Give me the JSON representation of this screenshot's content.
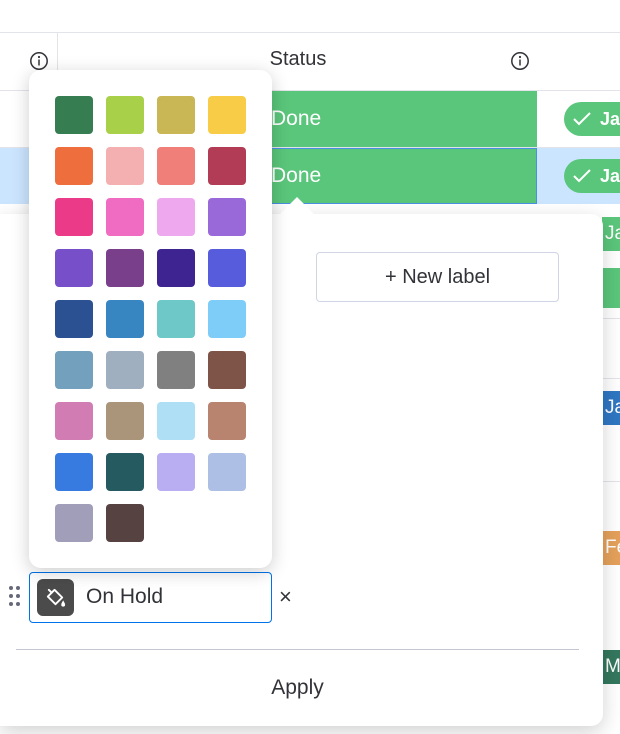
{
  "board": {
    "column_title": "Status",
    "rows": [
      {
        "status": "Done",
        "status_color": "#5ac67b",
        "date": "Jan",
        "selected": false
      },
      {
        "status": "Done",
        "status_color": "#5ac67b",
        "date": "Jan",
        "selected": true
      }
    ],
    "edge_chips": [
      {
        "text": "Ja",
        "color": "#5ac67b"
      },
      {
        "text": "",
        "color": "#5ac67b"
      },
      {
        "text": "Ja",
        "color": "#2f77c3"
      },
      {
        "text": "Fe",
        "color": "#e5a15b"
      },
      {
        "text": "M",
        "color": "#33785e"
      }
    ]
  },
  "label_editor": {
    "new_label_button": "+ New label",
    "label_value": "On Hold",
    "delete_symbol": "×",
    "apply_button": "Apply"
  },
  "color_picker": {
    "swatches": [
      "#367d52",
      "#a8d149",
      "#c9b755",
      "#f8cc46",
      "#ef6e3e",
      "#f4b0b0",
      "#ef7f78",
      "#b23c56",
      "#eb3a87",
      "#ef6cc2",
      "#eea9ee",
      "#9a69d9",
      "#7750c9",
      "#7a3f8a",
      "#3d2491",
      "#575cdc",
      "#2b5193",
      "#3786c2",
      "#6ec8c7",
      "#7ecdf8",
      "#73a1bd",
      "#a0afbf",
      "#808080",
      "#7d5447",
      "#d17db3",
      "#ab957a",
      "#aedff4",
      "#b8836f",
      "#387be0",
      "#245a60",
      "#baaef3",
      "#aebfe6",
      "#a19eba",
      "#574242"
    ]
  }
}
